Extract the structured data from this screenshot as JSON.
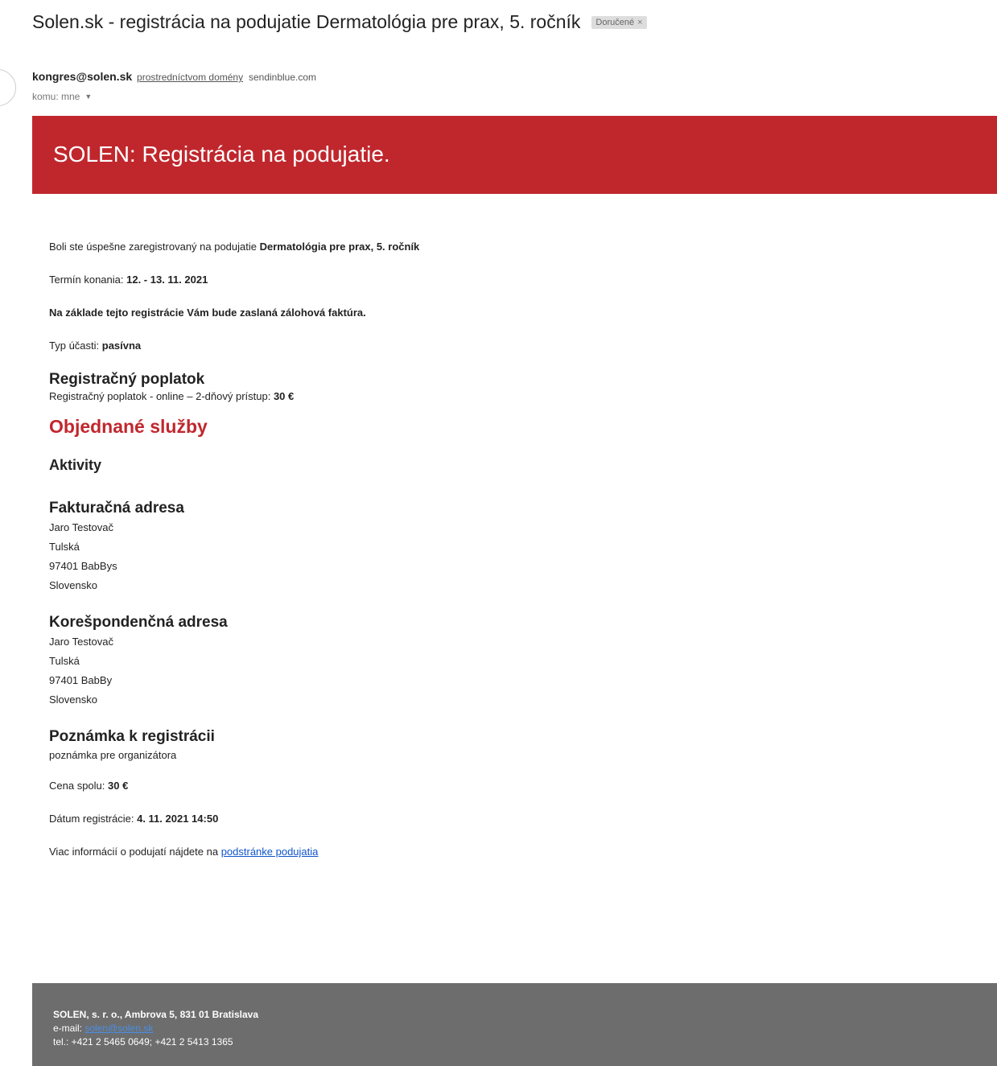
{
  "email": {
    "subject": "Solen.sk - registrácia na podujatie Dermatológia pre prax, 5. ročník",
    "label": "Doručené",
    "label_remove": "×",
    "sender_email": "kongres@solen.sk",
    "via_text": "prostredníctvom domény",
    "via_domain": "sendinblue.com",
    "to_text": "komu: mne",
    "to_caret": "▼"
  },
  "banner": {
    "title": "SOLEN: Registrácia na podujatie."
  },
  "body": {
    "intro_prefix": "Boli ste úspešne zaregistrovaný na podujatie ",
    "event_name": "Dermatológia pre prax, 5. ročník",
    "date_label": "Termín konania: ",
    "date_value": "12. - 13. 11. 2021",
    "invoice_note": "Na základe tejto registrácie Vám bude zaslaná zálohová faktúra.",
    "participation_label": "Typ účasti: ",
    "participation_value": "pasívna",
    "fee_heading": "Registračný poplatok",
    "fee_label": "Registračný poplatok - online – 2-dňový prístup: ",
    "fee_value": "30 €",
    "services_heading": "Objednané služby",
    "activities_heading": "Aktivity",
    "billing_heading": "Fakturačná adresa",
    "billing": [
      "Jaro Testovač",
      "Tulská",
      "97401 BabBys",
      "Slovensko"
    ],
    "correspondence_heading": "Korešpondenčná adresa",
    "correspondence": [
      "Jaro Testovač",
      "Tulská",
      "97401 BabBy",
      "Slovensko"
    ],
    "note_heading": "Poznámka k registrácii",
    "note_text": "poznámka pre organizátora",
    "total_label": "Cena spolu: ",
    "total_value": "30 €",
    "reg_date_label": "Dátum registrácie: ",
    "reg_date_value": "4. 11. 2021 14:50",
    "more_info_prefix": "Viac informácií o podujatí nájdete na ",
    "more_info_link": "podstránke podujatia"
  },
  "footer": {
    "company": "SOLEN, s. r. o., Ambrova 5, 831 01 Bratislava",
    "email_label": "e-mail: ",
    "email_value": "solen@solen.sk",
    "phone": "tel.: +421 2 5465 0649; +421 2 5413 1365"
  },
  "colors": {
    "banner": "#c0272d",
    "footer": "#6d6d6d",
    "link": "#1155cc"
  }
}
